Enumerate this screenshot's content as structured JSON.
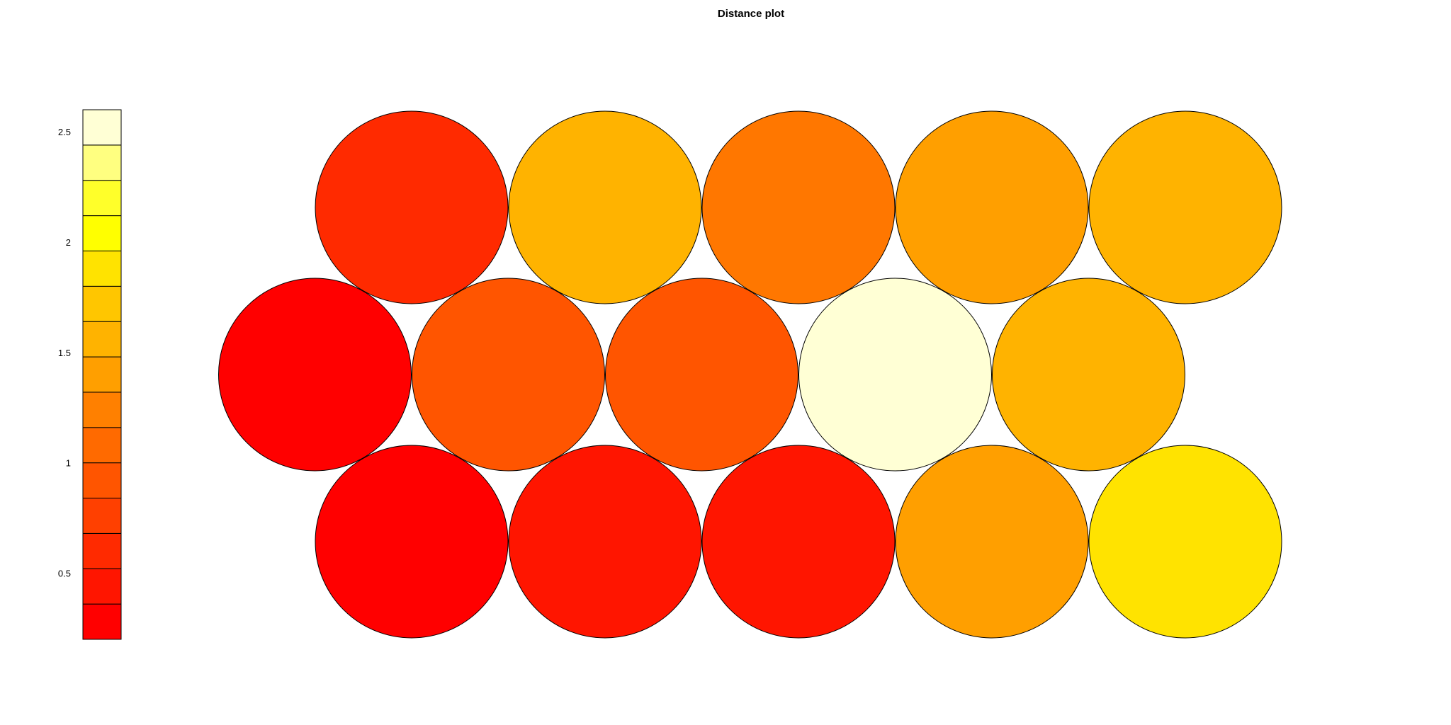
{
  "chart_data": {
    "type": "hexagonal-map",
    "title": "Distance plot",
    "color_scale": {
      "ticks": [
        "0.5",
        "1",
        "1.5",
        "2",
        "2.5"
      ],
      "tick_values": [
        0.5,
        1,
        1.5,
        2,
        2.5
      ],
      "range": [
        0.2,
        2.6
      ],
      "bins": [
        {
          "from": 0.2,
          "to": 0.36,
          "color": "#FF0000"
        },
        {
          "from": 0.36,
          "to": 0.52,
          "color": "#FF1500"
        },
        {
          "from": 0.52,
          "to": 0.68,
          "color": "#FF2A00"
        },
        {
          "from": 0.68,
          "to": 0.84,
          "color": "#FF4000"
        },
        {
          "from": 0.84,
          "to": 1.0,
          "color": "#FF5500"
        },
        {
          "from": 1.0,
          "to": 1.16,
          "color": "#FF6A00"
        },
        {
          "from": 1.16,
          "to": 1.32,
          "color": "#FF8000"
        },
        {
          "from": 1.32,
          "to": 1.48,
          "color": "#FF9F00"
        },
        {
          "from": 1.48,
          "to": 1.64,
          "color": "#FFB300"
        },
        {
          "from": 1.64,
          "to": 1.8,
          "color": "#FFC600"
        },
        {
          "from": 1.8,
          "to": 1.96,
          "color": "#FFE300"
        },
        {
          "from": 1.96,
          "to": 2.12,
          "color": "#FFFF00"
        },
        {
          "from": 2.12,
          "to": 2.28,
          "color": "#FFFF2A"
        },
        {
          "from": 2.28,
          "to": 2.44,
          "color": "#FFFF80"
        },
        {
          "from": 2.44,
          "to": 2.6,
          "color": "#FFFFD5"
        }
      ]
    },
    "grid": {
      "rows": 3,
      "columns": 5,
      "topology": "hexagonal"
    },
    "units": [
      {
        "row": 0,
        "col": 0,
        "value": 0.62,
        "color": "#FF2A00"
      },
      {
        "row": 0,
        "col": 1,
        "value": 1.55,
        "color": "#FFB300"
      },
      {
        "row": 0,
        "col": 2,
        "value": 1.25,
        "color": "#FF7700"
      },
      {
        "row": 0,
        "col": 3,
        "value": 1.42,
        "color": "#FF9F00"
      },
      {
        "row": 0,
        "col": 4,
        "value": 1.55,
        "color": "#FFB300"
      },
      {
        "row": 1,
        "col": 0,
        "value": 0.25,
        "color": "#FF0000"
      },
      {
        "row": 1,
        "col": 1,
        "value": 1.02,
        "color": "#FF5500"
      },
      {
        "row": 1,
        "col": 2,
        "value": 1.05,
        "color": "#FF5500"
      },
      {
        "row": 1,
        "col": 3,
        "value": 2.55,
        "color": "#FFFFD5"
      },
      {
        "row": 1,
        "col": 4,
        "value": 1.58,
        "color": "#FFB300"
      },
      {
        "row": 2,
        "col": 0,
        "value": 0.3,
        "color": "#FF0000"
      },
      {
        "row": 2,
        "col": 1,
        "value": 0.48,
        "color": "#FF1500"
      },
      {
        "row": 2,
        "col": 2,
        "value": 0.48,
        "color": "#FF1500"
      },
      {
        "row": 2,
        "col": 3,
        "value": 1.42,
        "color": "#FF9F00"
      },
      {
        "row": 2,
        "col": 4,
        "value": 1.9,
        "color": "#FFE300"
      }
    ]
  }
}
